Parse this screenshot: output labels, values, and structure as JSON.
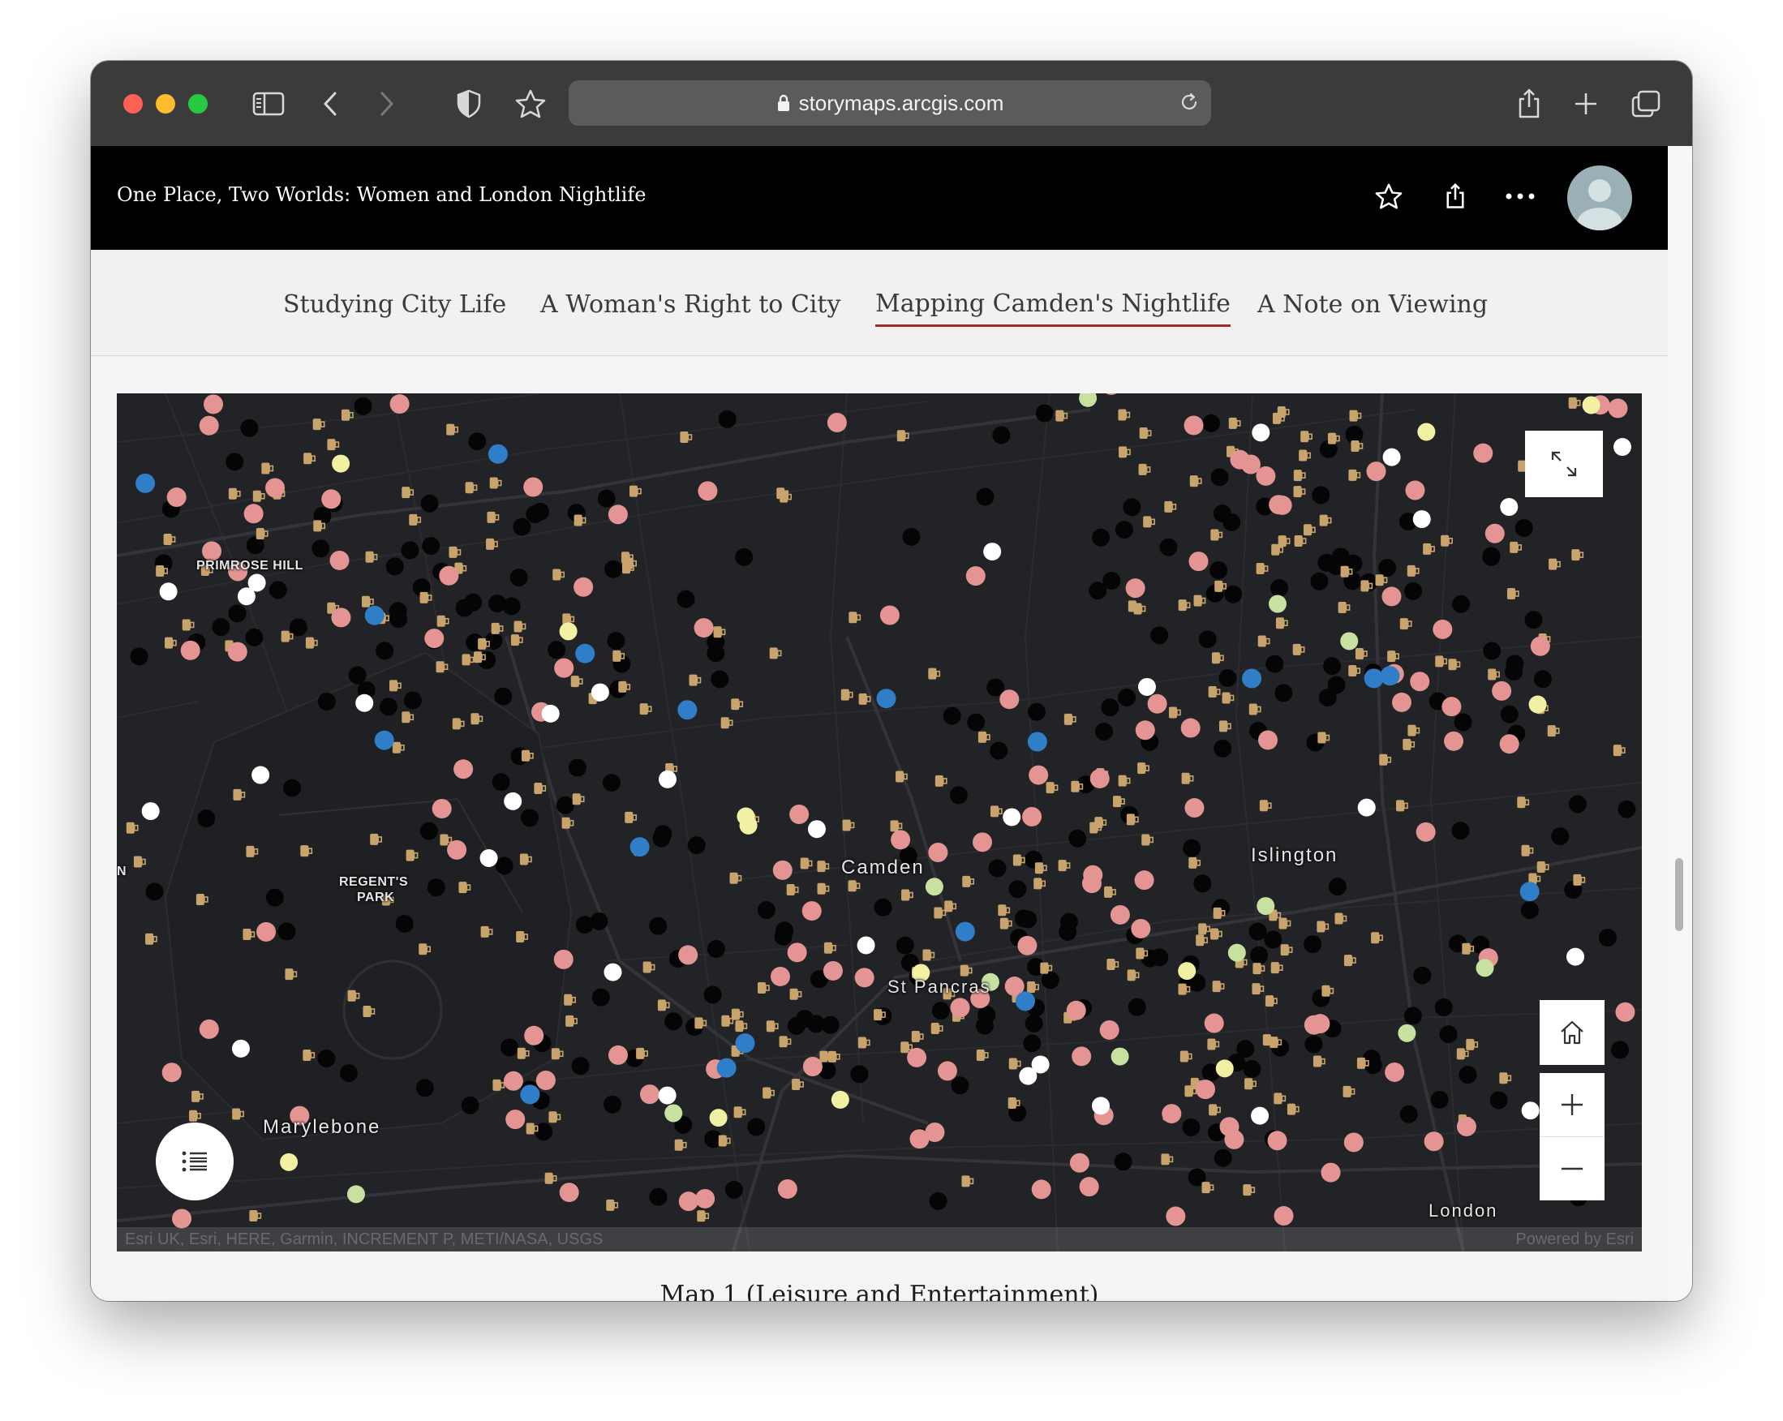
{
  "browser": {
    "url": "storymaps.arcgis.com",
    "icons": [
      "sidebar-icon",
      "back-icon",
      "forward-icon",
      "shield-icon",
      "star-icon",
      "lock-icon",
      "reload-icon",
      "share-icon",
      "new-tab-icon",
      "tabs-icon"
    ]
  },
  "story": {
    "title": "One Place, Two Worlds: Women and London Nightlife",
    "header_icons": [
      "star-icon",
      "share-icon",
      "more-icon",
      "avatar"
    ]
  },
  "nav": {
    "items": [
      {
        "label": "Studying City Life"
      },
      {
        "label": "A Woman's Right to City"
      },
      {
        "label": "Mapping Camden's Nightlife",
        "active": true
      },
      {
        "label": "A Note on Viewing"
      }
    ]
  },
  "map": {
    "labels": {
      "primrose_hill": "PRIMROSE HILL",
      "regents_park_1": "REGENT'S",
      "regents_park_2": "PARK",
      "camden": "Camden",
      "islington": "Islington",
      "st_pancras": "St Pancras",
      "marylebone": "Marylebone",
      "london": "London",
      "edge_n": "N"
    },
    "attribution": "Esri UK, Esri, HERE, Garmin, INCREMENT P, METI/NASA, USGS",
    "powered_by": "Powered by Esri",
    "controls": [
      "expand-icon",
      "home-icon",
      "zoom-in-icon",
      "zoom-out-icon",
      "legend-icon"
    ],
    "colors": {
      "base": "#222326",
      "pink": "#e49593",
      "white": "#ffffff",
      "yellow": "#f2f0a2",
      "green": "#c8e0a0",
      "black": "#050505",
      "blue": "#2f7ec7",
      "pub": "#c9a36c"
    }
  },
  "caption": "Map 1 (Leisure and Entertainment)"
}
